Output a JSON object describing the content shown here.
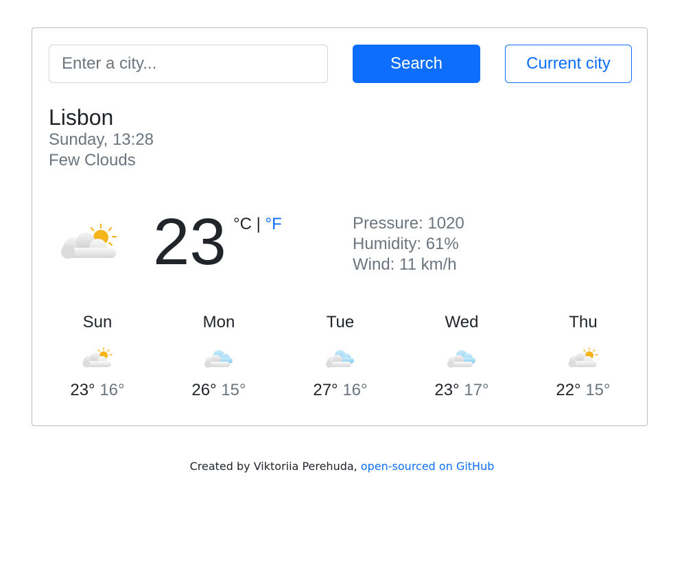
{
  "search": {
    "placeholder": "Enter a city...",
    "value": "",
    "search_label": "Search",
    "current_label": "Current city"
  },
  "current": {
    "city": "Lisbon",
    "datetime": "Sunday, 13:28",
    "description": "Few Clouds",
    "icon": "few-clouds-icon",
    "temperature": "23",
    "unit_c": "°C",
    "unit_sep": " | ",
    "unit_f": "°F",
    "pressure": "Pressure: 1020",
    "humidity": "Humidity: 61%",
    "wind": "Wind: 11 km/h"
  },
  "forecast": [
    {
      "day": "Sun",
      "icon": "few-clouds-icon",
      "max": "23°",
      "min": "16°"
    },
    {
      "day": "Mon",
      "icon": "cloudy-icon",
      "max": "26°",
      "min": "15°"
    },
    {
      "day": "Tue",
      "icon": "cloudy-icon",
      "max": "27°",
      "min": "16°"
    },
    {
      "day": "Wed",
      "icon": "cloudy-icon",
      "max": "23°",
      "min": "17°"
    },
    {
      "day": "Thu",
      "icon": "few-clouds-icon",
      "max": "22°",
      "min": "15°"
    }
  ],
  "footer": {
    "text": "Created by Viktoriia Perehuda, ",
    "link": "open-sourced on GitHub"
  },
  "colors": {
    "accent": "#0d6efd",
    "muted": "#6c757d",
    "sun": "#f4b41a",
    "cloud_blue": "#8fd3f4"
  }
}
